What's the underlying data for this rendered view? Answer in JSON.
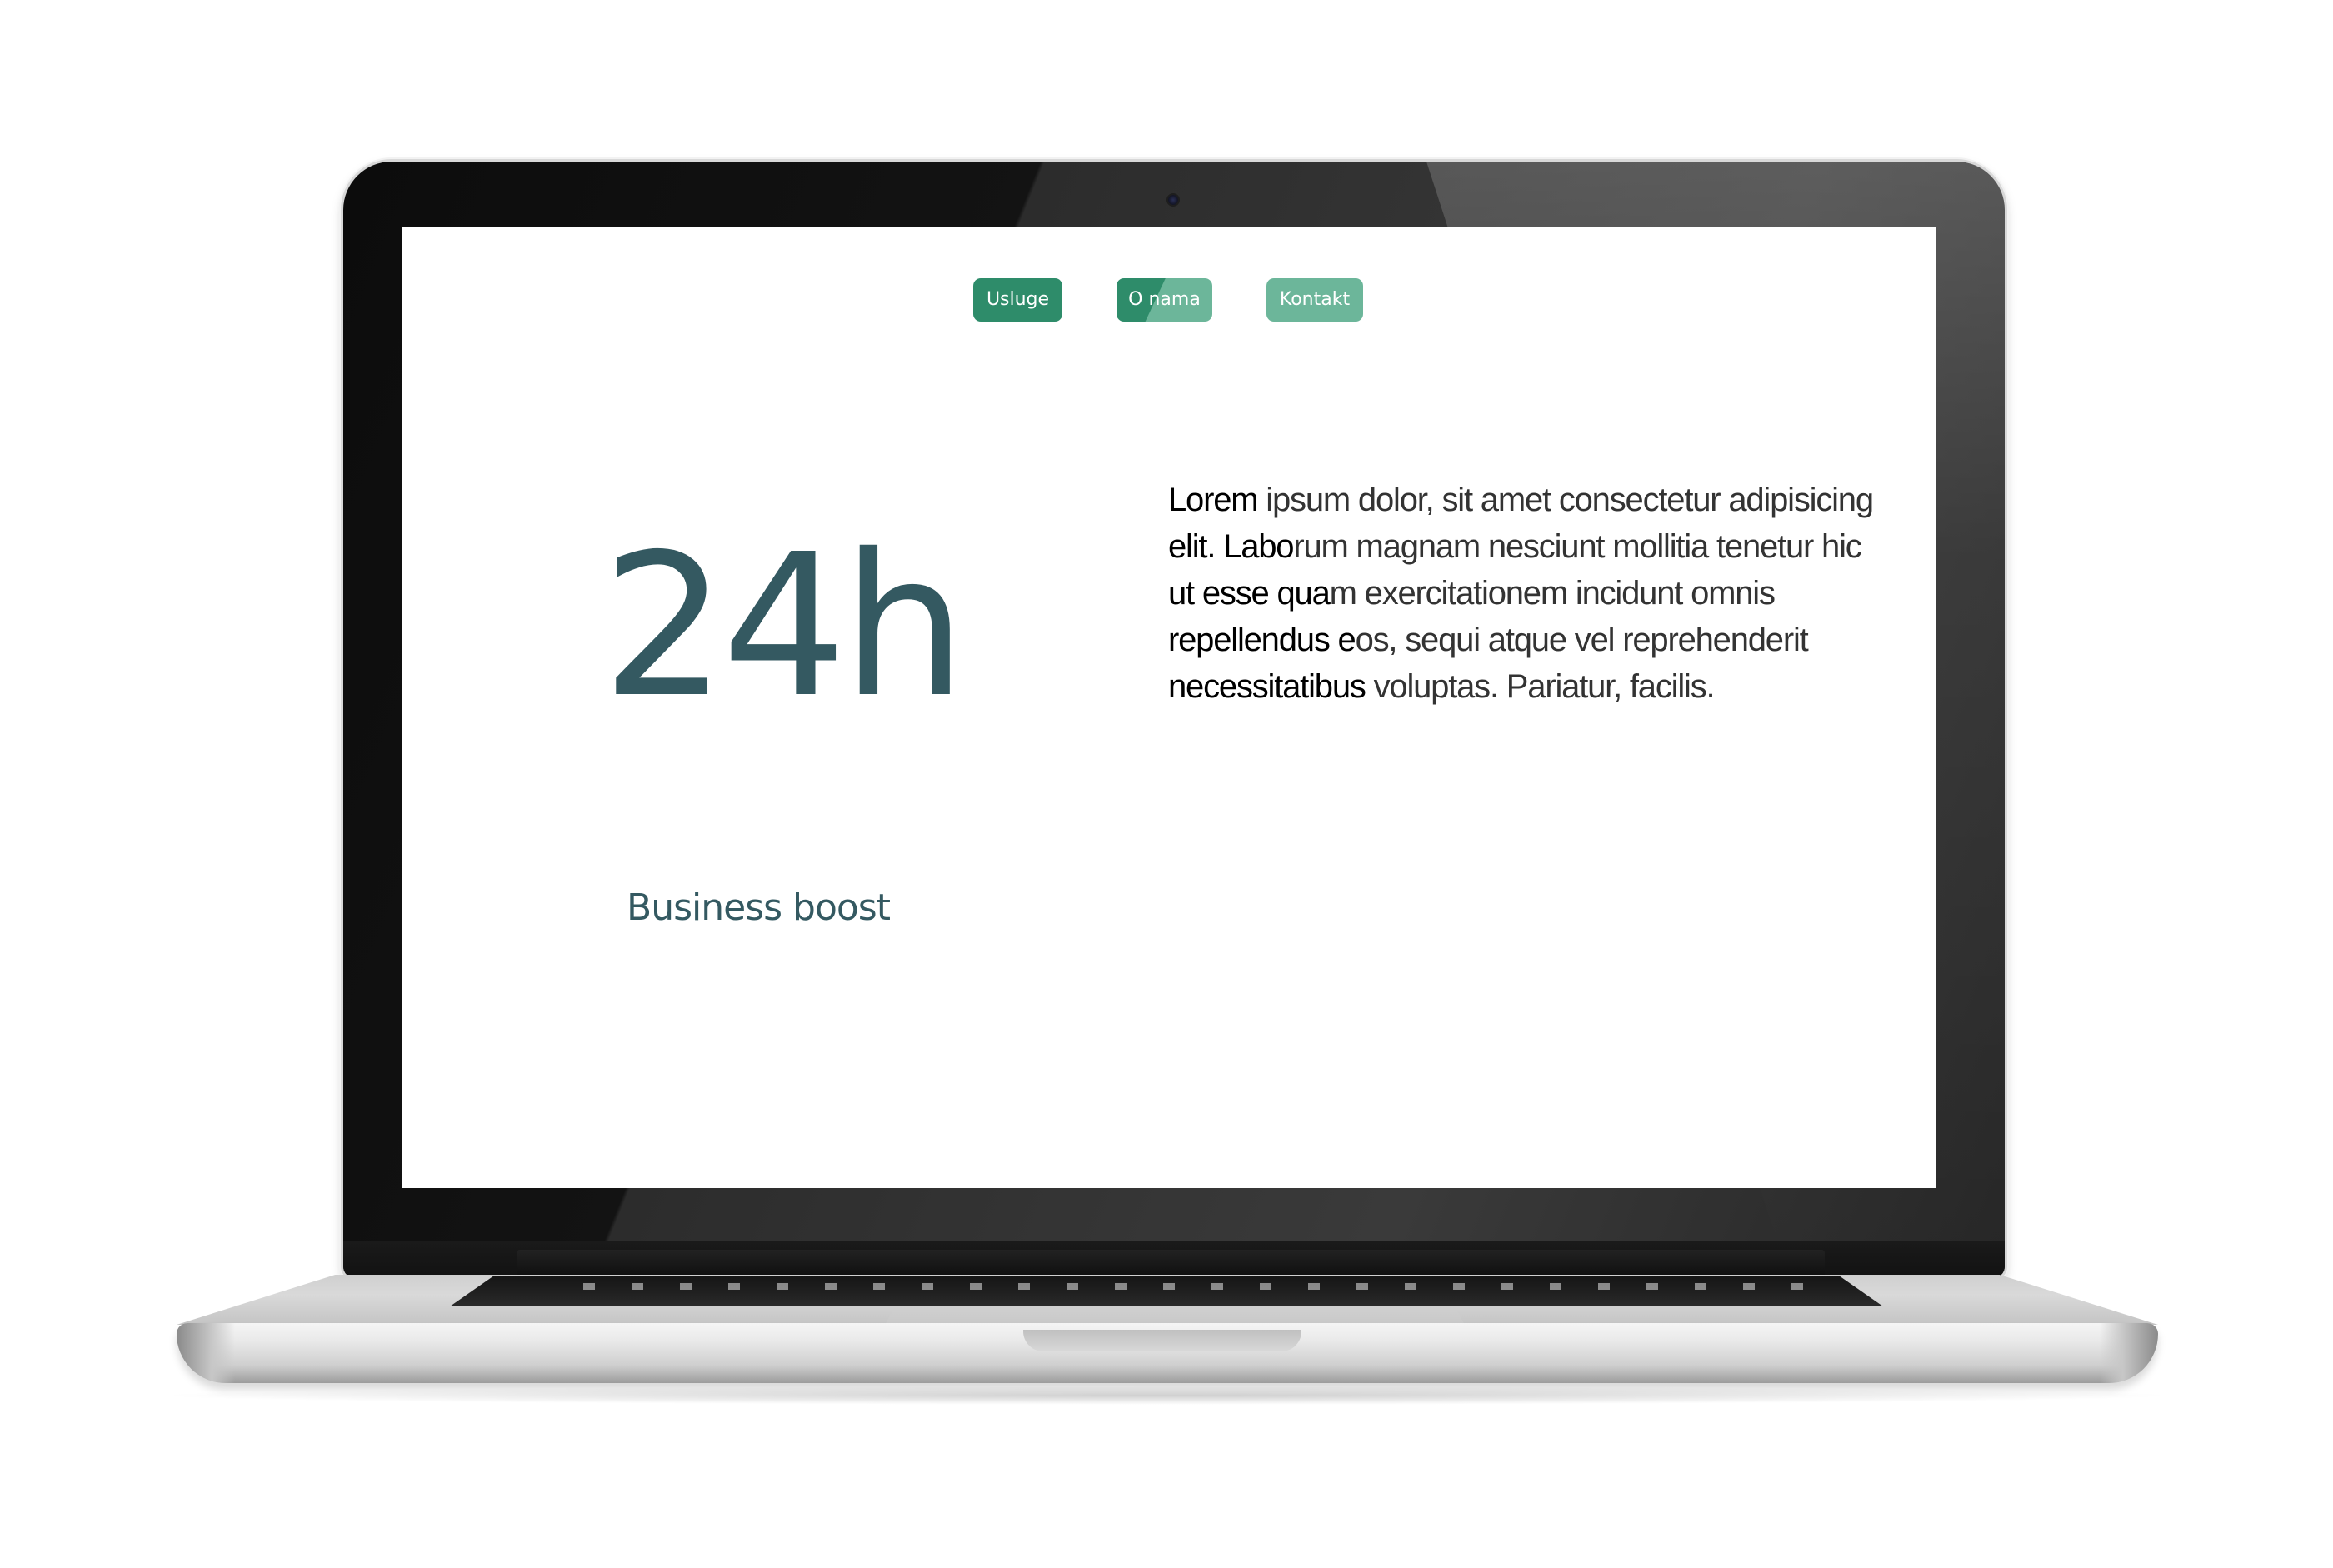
{
  "nav": {
    "items": [
      {
        "label": "Usluge"
      },
      {
        "label": "O nama"
      },
      {
        "label": "Kontakt"
      }
    ]
  },
  "hero": {
    "stat": "24h",
    "tagline": "Business boost",
    "paragraph": {
      "segments": [
        {
          "text": "Lorem",
          "emphasis": true
        },
        {
          "text": " ipsum dolor, sit amet consectetur adipisicing ",
          "emphasis": false
        },
        {
          "text": "elit. Labo",
          "emphasis": true
        },
        {
          "text": "rum magnam nesciunt mollitia tenetur hic ",
          "emphasis": false
        },
        {
          "text": "ut esse qua",
          "emphasis": true
        },
        {
          "text": "m exercitationem incidunt omnis ",
          "emphasis": false
        },
        {
          "text": "repellendus e",
          "emphasis": true
        },
        {
          "text": "os, sequi atque vel reprehenderit ",
          "emphasis": false
        },
        {
          "text": "necessitatibus",
          "emphasis": true
        },
        {
          "text": " voluptas. Pariatur, facilis.",
          "emphasis": false
        }
      ]
    }
  },
  "colors": {
    "accent_dark": "#2e8c6a",
    "accent_light": "#6cb69a",
    "stat_text": "#345961"
  }
}
